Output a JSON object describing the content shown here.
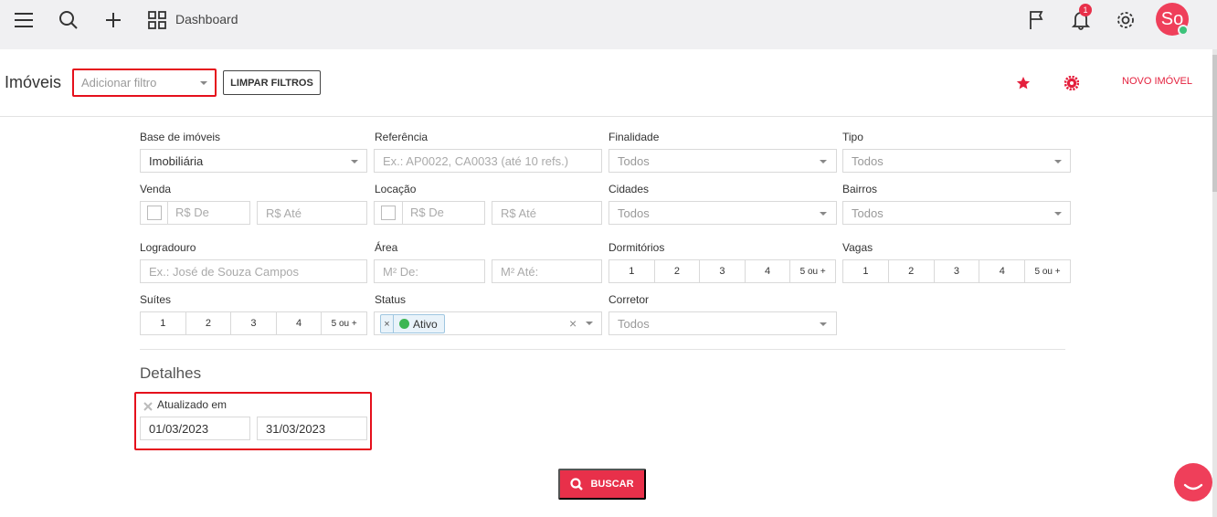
{
  "topbar": {
    "menu_icon": "hamburger-icon",
    "search_icon": "search-icon",
    "add_icon": "plus-icon",
    "dashboard_icon": "grid-icon",
    "dashboard_label": "Dashboard",
    "flag_icon": "flag-icon",
    "bell_icon": "bell-icon",
    "notification_count": "1",
    "settings_icon": "gear-icon",
    "avatar_initials": "So"
  },
  "subbar": {
    "page_title": "Imóveis",
    "filter_placeholder": "Adicionar filtro",
    "clear_filters_label": "LIMPAR FILTROS",
    "favorite_icon": "star-icon",
    "config_icon": "gear-icon",
    "new_property_label": "NOVO IMÓVEL"
  },
  "filters": {
    "base": {
      "label": "Base de imóveis",
      "value": "Imobiliária"
    },
    "referencia": {
      "label": "Referência",
      "placeholder": "Ex.: AP0022, CA0033 (até 10 refs.)"
    },
    "finalidade": {
      "label": "Finalidade",
      "value": "Todos"
    },
    "tipo": {
      "label": "Tipo",
      "value": "Todos"
    },
    "venda": {
      "label": "Venda",
      "from_placeholder": "R$ De",
      "to_placeholder": "R$ Até"
    },
    "locacao": {
      "label": "Locação",
      "from_placeholder": "R$ De",
      "to_placeholder": "R$ Até"
    },
    "cidades": {
      "label": "Cidades",
      "value": "Todos"
    },
    "bairros": {
      "label": "Bairros",
      "value": "Todos"
    },
    "logradouro": {
      "label": "Logradouro",
      "placeholder": "Ex.: José de Souza Campos"
    },
    "area": {
      "label": "Área",
      "from_placeholder": "M² De:",
      "to_placeholder": "M² Até:"
    },
    "dormitorios": {
      "label": "Dormitórios",
      "options": [
        "1",
        "2",
        "3",
        "4",
        "5 ou +"
      ]
    },
    "vagas": {
      "label": "Vagas",
      "options": [
        "1",
        "2",
        "3",
        "4",
        "5 ou +"
      ]
    },
    "suites": {
      "label": "Suítes",
      "options": [
        "1",
        "2",
        "3",
        "4",
        "5 ou +"
      ]
    },
    "status": {
      "label": "Status",
      "tag_label": "Ativo",
      "tag_remove": "×",
      "clear": "×"
    },
    "corretor": {
      "label": "Corretor",
      "value": "Todos"
    }
  },
  "details": {
    "title": "Detalhes",
    "updated_label": "Atualizado em",
    "remove_icon": "close-icon",
    "date_from": "01/03/2023",
    "date_to": "31/03/2023"
  },
  "search_button": {
    "label": "BUSCAR",
    "icon": "search-icon"
  },
  "chat_icon": "chat-icon",
  "colors": {
    "accent": "#e8304a",
    "highlight_border": "#e5101c",
    "status_active": "#3cb653",
    "topbar_bg": "#f0f0f2"
  }
}
